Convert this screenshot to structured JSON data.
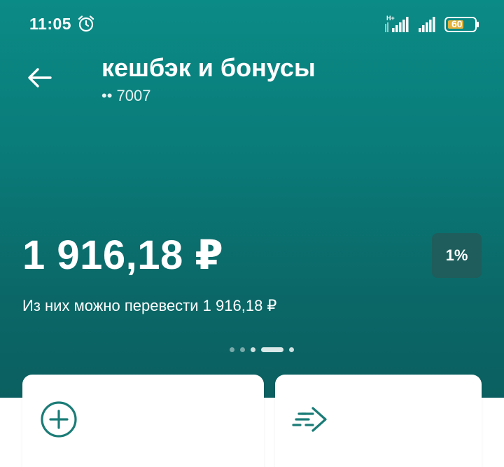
{
  "status_bar": {
    "time": "11:05",
    "battery": "60",
    "network_label": "H+",
    "icons": [
      "alarm-icon",
      "signal-icon",
      "signal-icon",
      "battery-icon"
    ]
  },
  "header": {
    "back_icon": "arrow-left-icon",
    "title": "кешбэк и бонусы",
    "card_mask": "•• 7007"
  },
  "balance": {
    "amount": "1 916,18 ₽",
    "rate_badge": "1%",
    "transfer_note": "Из них можно перевести 1 916,18 ₽"
  },
  "pager": {
    "count": 5,
    "active_index": 3
  },
  "actions": [
    {
      "icon": "plus-circle-icon"
    },
    {
      "icon": "fast-arrow-icon"
    }
  ],
  "colors": {
    "hero_top": "#0b8b86",
    "hero_bottom": "#0b5f60",
    "badge_bg": "#1e5d5b",
    "icon_accent": "#1b7c77"
  }
}
